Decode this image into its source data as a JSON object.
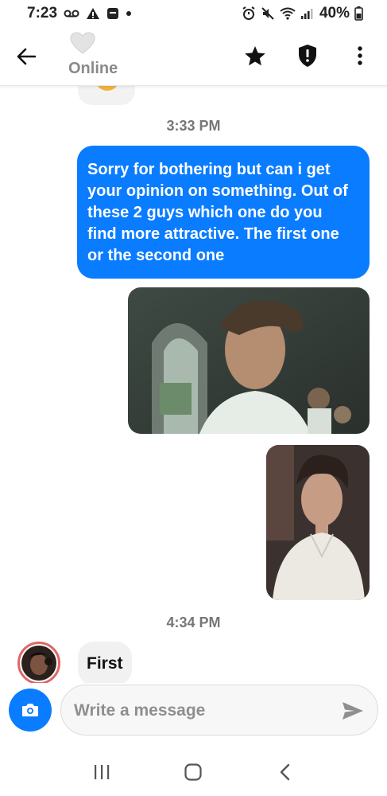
{
  "status_bar": {
    "time": "7:23",
    "battery": "40%",
    "icons_left": [
      "voicemail-icon",
      "warning-icon",
      "app-notification-icon",
      "dot-icon"
    ],
    "icons_right": [
      "alarm-icon",
      "mute-icon",
      "wifi-icon",
      "signal-icon",
      "battery-icon"
    ]
  },
  "header": {
    "presence_label": "Online",
    "presence_icon": "heart-icon",
    "actions": [
      "star-icon",
      "shield-icon",
      "more-vertical-icon"
    ]
  },
  "messages": {
    "time_1": "3:33 PM",
    "outgoing_text": "Sorry for bothering but can i get your opinion on something. Out of these 2 guys which one do you find more attractive. The first one or the second one",
    "time_2": "4:34 PM",
    "incoming_text": "First"
  },
  "composer": {
    "placeholder": "Write a message",
    "value": ""
  },
  "colors": {
    "accent": "#0a7cff",
    "incoming_bubble": "#f1f1f1",
    "avatar_ring": "#e06666",
    "timestamp": "#777777"
  },
  "nav_bar": [
    "recent-apps-icon",
    "home-icon",
    "back-icon"
  ]
}
